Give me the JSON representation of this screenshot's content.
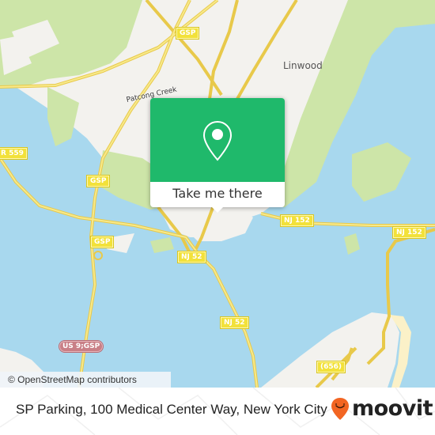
{
  "map": {
    "place_labels": [
      {
        "id": "linwood",
        "text": "Linwood"
      }
    ],
    "water_labels": [
      {
        "id": "patcong-creek",
        "text": "Patcong Creek"
      }
    ],
    "road_shields": [
      {
        "id": "gsp-1",
        "text": "GSP",
        "type": "state"
      },
      {
        "id": "cr559",
        "text": "R 559",
        "type": "state"
      },
      {
        "id": "gsp-2",
        "text": "GSP",
        "type": "state"
      },
      {
        "id": "gsp-3",
        "text": "GSP",
        "type": "state"
      },
      {
        "id": "nj52-1",
        "text": "NJ 52",
        "type": "state"
      },
      {
        "id": "nj152-1",
        "text": "NJ 152",
        "type": "state"
      },
      {
        "id": "nj152-2",
        "text": "NJ 152",
        "type": "state"
      },
      {
        "id": "nj52-2",
        "text": "NJ 52",
        "type": "state"
      },
      {
        "id": "us9gsp",
        "text": "US 9;GSP",
        "type": "us"
      },
      {
        "id": "cr656",
        "text": "(656)",
        "type": "state"
      }
    ],
    "colors": {
      "water": "#a8d8ee",
      "land": "#f3f2ee",
      "park": "#cde5a8",
      "road": "#f5e36b",
      "beach": "#fbf1c8"
    },
    "attribution": "© OpenStreetMap contributors"
  },
  "popup": {
    "icon": "map-pin-icon",
    "action_label": "Take me there",
    "accent_color": "#1fb96b"
  },
  "footer": {
    "address": "SP Parking, 100 Medical Center Way, New York City",
    "brand": "moovit",
    "brand_color": "#f26522"
  }
}
